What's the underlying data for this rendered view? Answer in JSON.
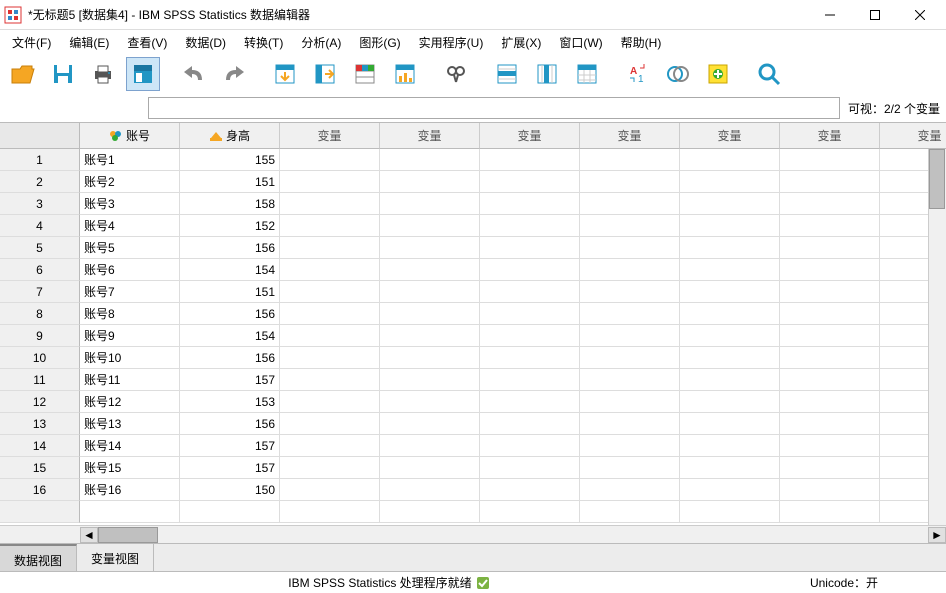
{
  "window": {
    "title": "*无标题5 [数据集4] - IBM SPSS Statistics 数据编辑器"
  },
  "menu": {
    "file": "文件(F)",
    "edit": "编辑(E)",
    "view": "查看(V)",
    "data": "数据(D)",
    "transform": "转换(T)",
    "analyze": "分析(A)",
    "graphs": "图形(G)",
    "utilities": "实用程序(U)",
    "extensions": "扩展(X)",
    "window": "窗口(W)",
    "help": "帮助(H)"
  },
  "search": {
    "visible_label": "可视：2/2 个变量"
  },
  "columns": {
    "c1": "账号",
    "c2": "身高",
    "var": "变量",
    "lastvar": "变"
  },
  "rows": [
    {
      "n": "1",
      "a": "账号1",
      "h": "155"
    },
    {
      "n": "2",
      "a": "账号2",
      "h": "151"
    },
    {
      "n": "3",
      "a": "账号3",
      "h": "158"
    },
    {
      "n": "4",
      "a": "账号4",
      "h": "152"
    },
    {
      "n": "5",
      "a": "账号5",
      "h": "156"
    },
    {
      "n": "6",
      "a": "账号6",
      "h": "154"
    },
    {
      "n": "7",
      "a": "账号7",
      "h": "151"
    },
    {
      "n": "8",
      "a": "账号8",
      "h": "156"
    },
    {
      "n": "9",
      "a": "账号9",
      "h": "154"
    },
    {
      "n": "10",
      "a": "账号10",
      "h": "156"
    },
    {
      "n": "11",
      "a": "账号11",
      "h": "157"
    },
    {
      "n": "12",
      "a": "账号12",
      "h": "153"
    },
    {
      "n": "13",
      "a": "账号13",
      "h": "156"
    },
    {
      "n": "14",
      "a": "账号14",
      "h": "157"
    },
    {
      "n": "15",
      "a": "账号15",
      "h": "157"
    },
    {
      "n": "16",
      "a": "账号16",
      "h": "150"
    }
  ],
  "tabs": {
    "data_view": "数据视图",
    "variable_view": "变量视图"
  },
  "status": {
    "ready": "IBM SPSS Statistics 处理程序就绪",
    "unicode": "Unicode：开"
  }
}
